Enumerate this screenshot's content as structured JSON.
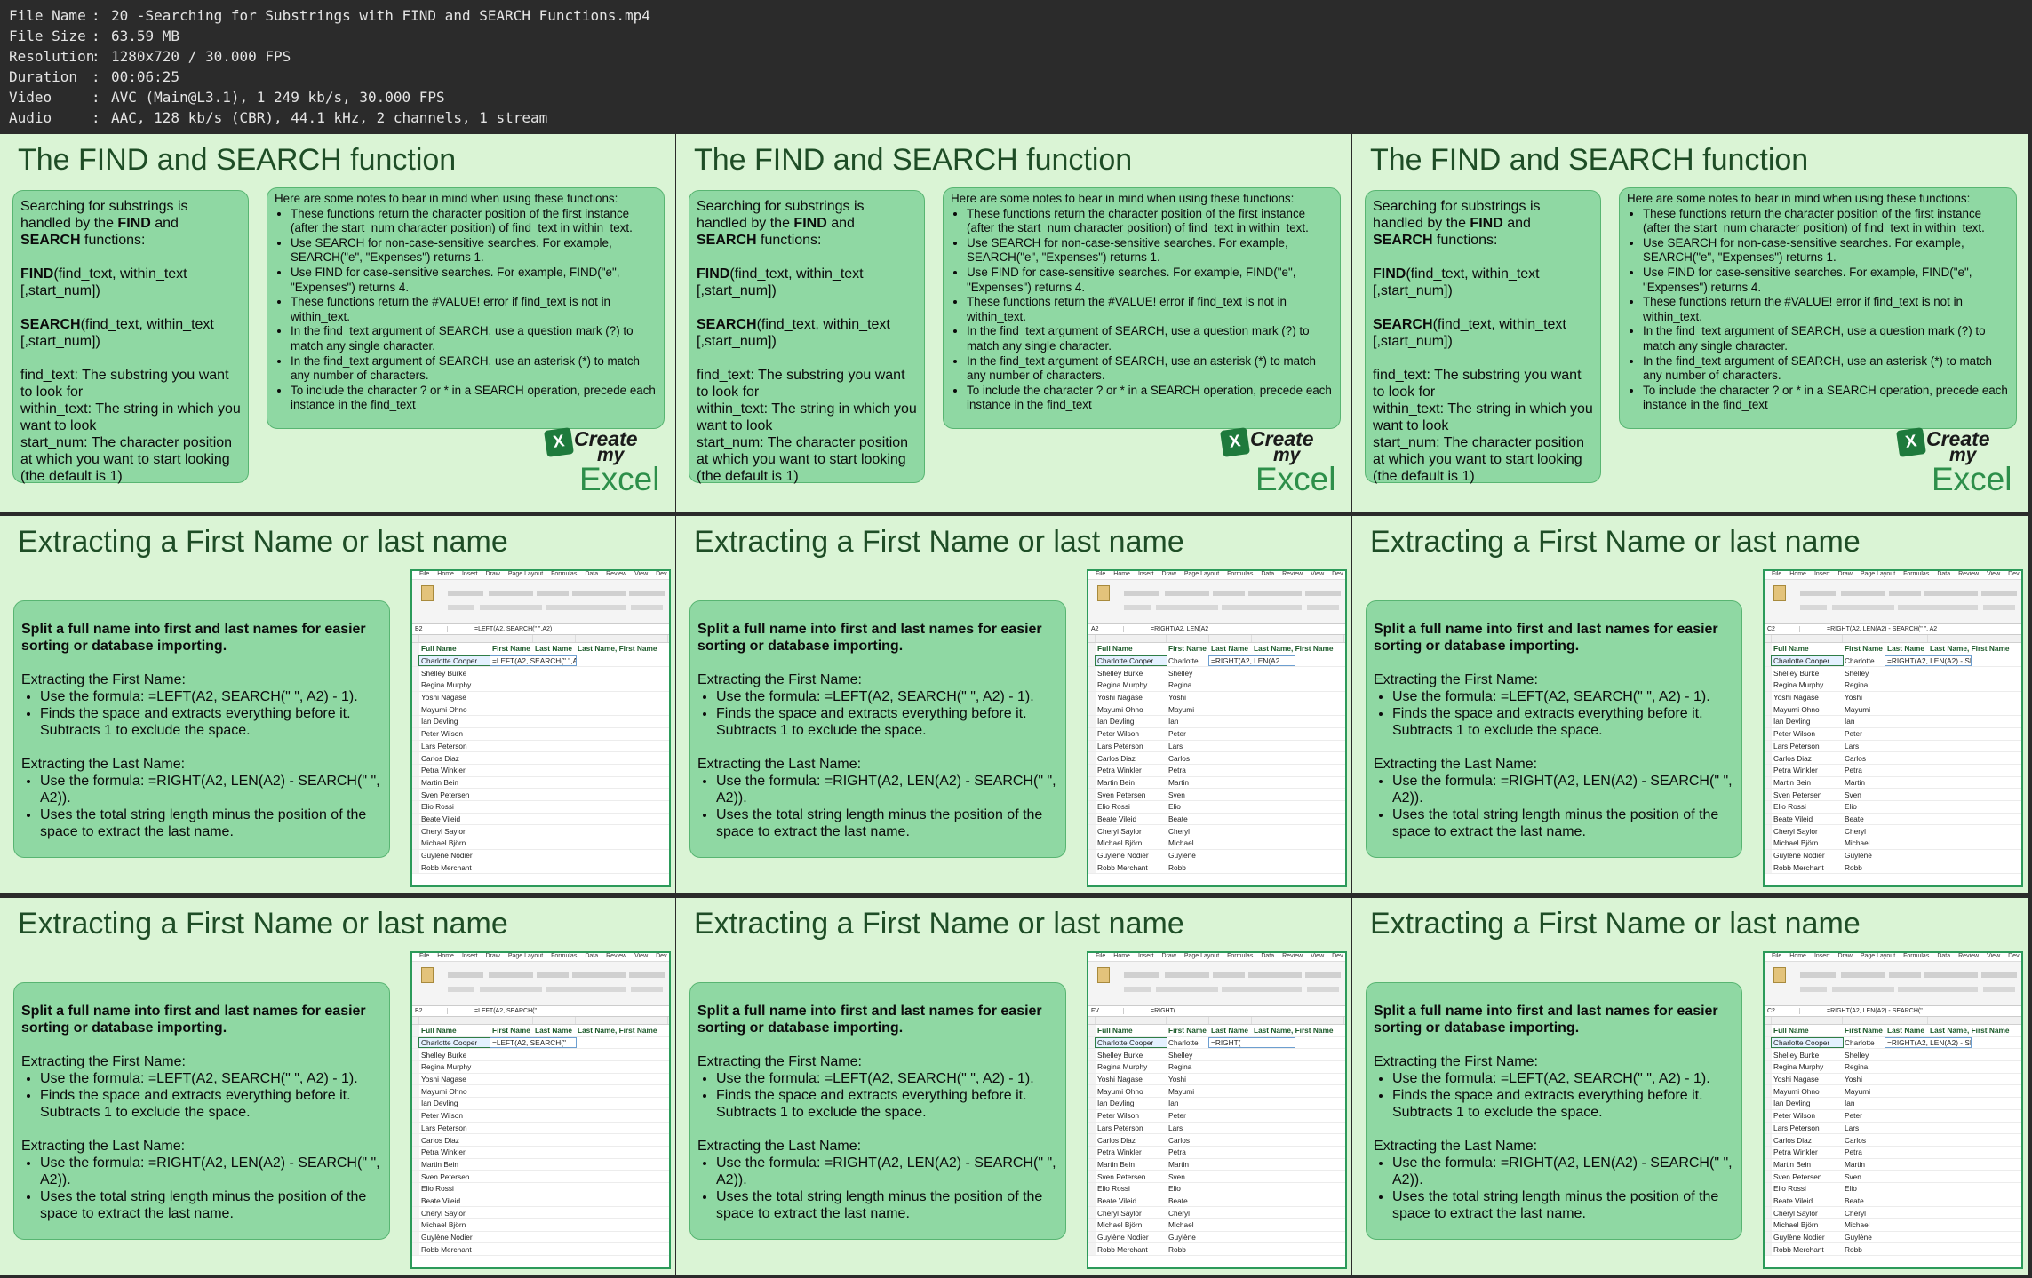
{
  "info": [
    {
      "key": "File Name",
      "value": "20 -Searching for Substrings with FIND and SEARCH Functions.mp4"
    },
    {
      "key": "File Size",
      "value": "63.59 MB"
    },
    {
      "key": "Resolution",
      "value": "1280x720 / 30.000 FPS"
    },
    {
      "key": "Duration",
      "value": "00:06:25"
    },
    {
      "key": "Video",
      "value": "AVC (Main@L3.1), 1 249 kb/s, 30.000 FPS"
    },
    {
      "key": "Audio",
      "value": "AAC, 128 kb/s (CBR), 44.1 kHz, 2 channels, 1 stream"
    }
  ],
  "sep": ":",
  "find_slide": {
    "title": "The FIND and SEARCH function",
    "left_intro_1": "Searching for substrings is handled by the ",
    "left_intro_b1": "FIND",
    "left_intro_2": " and ",
    "left_intro_b2": "SEARCH",
    "left_intro_3": " functions:",
    "find_name": "FIND",
    "find_args": "(find_text, within_text [,start_num])",
    "search_name": "SEARCH",
    "search_args": "(find_text, within_text [,start_num])",
    "param_1": "find_text: The substring you want to look for",
    "param_2": "within_text: The string in which you want to look",
    "param_3": "start_num: The character position at which you want to start looking (the default is 1)",
    "notes_intro": "Here are some notes to bear in mind when using these functions:",
    "notes": [
      "These functions return the character position of the first instance (after the start_num character position) of find_text in within_text.",
      "Use SEARCH for non-case-sensitive searches. For example, SEARCH(\"e\", \"Expenses\") returns 1.",
      "Use FIND for case-sensitive searches. For example, FIND(\"e\", \"Expenses\") returns 4.",
      "These functions return the #VALUE! error if find_text is not in within_text.",
      "In the find_text argument of SEARCH, use a question mark (?) to match any single character.",
      "In the find_text argument of SEARCH, use an asterisk (*) to match any number of characters.",
      "To include the character ? or * in a SEARCH operation, precede each instance in the find_text"
    ],
    "logo": {
      "line1": "Create",
      "line2": "my",
      "line3": "Excel",
      "icon": "X"
    }
  },
  "extract_slide": {
    "title": "Extracting a First Name or last name",
    "heading": "Split a full name into first and last names for easier sorting or database importing.",
    "first_label": "Extracting the First Name:",
    "first_items": [
      "Use the formula: =LEFT(A2, SEARCH(\" \", A2) - 1).",
      "Finds the space and extracts everything before it. Subtracts 1 to exclude the space."
    ],
    "last_label": "Extracting the Last Name:",
    "last_items": [
      "Use the formula: =RIGHT(A2, LEN(A2) - SEARCH(\" \", A2)).",
      "Uses the total string length minus the position of the space to extract the last name."
    ]
  },
  "excel": {
    "menu": [
      "File",
      "Home",
      "Insert",
      "Draw",
      "Page Layout",
      "Formulas",
      "Data",
      "Review",
      "View",
      "Dev"
    ],
    "headers": [
      "Full Name",
      "First Name",
      "Last Name",
      "Last Name, First Name"
    ],
    "names": [
      "Charlotte Cooper",
      "Shelley Burke",
      "Regina Murphy",
      "Yoshi Nagase",
      "Mayumi Ohno",
      "Ian Devling",
      "Peter Wilson",
      "Lars Peterson",
      "Carlos Diaz",
      "Petra Winkler",
      "Martin Bein",
      "Sven Petersen",
      "Elio Rossi",
      "Beate Vileid",
      "Cheryl Saylor",
      "Michael Björn",
      "Guylène Nodier",
      "Robb Merchant"
    ],
    "firsts": [
      "Charlotte",
      "Shelley",
      "Regina",
      "Yoshi",
      "Mayumi",
      "Ian",
      "Peter",
      "Lars",
      "Carlos",
      "Petra",
      "Martin",
      "Sven",
      "Elio",
      "Beate",
      "Cheryl",
      "Michael",
      "Guylène",
      "Robb"
    ]
  },
  "frames": [
    {
      "kind": "find"
    },
    {
      "kind": "find"
    },
    {
      "kind": "find"
    },
    {
      "kind": "extract",
      "cellref": "B2",
      "formula": "=LEFT(A2, SEARCH(\" \",A2)",
      "editcol": "b",
      "showfirst": false,
      "editval": "=LEFT(A2, SEARCH(\" \",A2)"
    },
    {
      "kind": "extract",
      "cellref": "A2",
      "formula": "=RIGHT(A2, LEN(A2",
      "editcol": "c",
      "showfirst": true,
      "editval": "=RIGHT(A2, LEN(A2"
    },
    {
      "kind": "extract",
      "cellref": "C2",
      "formula": "=RIGHT(A2, LEN(A2) - SEARCH(\" \", A2",
      "editcol": "c",
      "showfirst": true,
      "editval": "=RIGHT(A2, LEN(A2) - SEARCH(\" \", A"
    },
    {
      "kind": "extract",
      "cellref": "B2",
      "formula": "=LEFT(A2, SEARCH(\"",
      "editcol": "b",
      "showfirst": false,
      "editval": "=LEFT(A2, SEARCH(\""
    },
    {
      "kind": "extract",
      "cellref": "FV",
      "formula": "=RIGHT(",
      "editcol": "c",
      "showfirst": true,
      "editval": "=RIGHT("
    },
    {
      "kind": "extract",
      "cellref": "C2",
      "formula": "=RIGHT(A2, LEN(A2) - SEARCH(\"",
      "editcol": "c",
      "showfirst": true,
      "editval": "=RIGHT(A2, LEN(A2) - SEARCH(\""
    }
  ]
}
